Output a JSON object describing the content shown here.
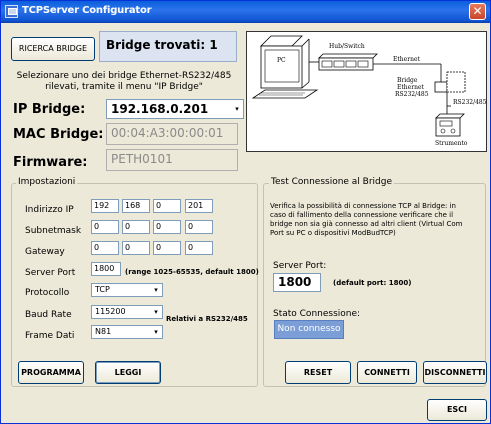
{
  "window": {
    "title": "TCPServer Configurator"
  },
  "header": {
    "search_button": "RICERCA BRIDGE",
    "found_label": "Bridge trovati: 1",
    "instruction_line1": "Selezionare uno dei bridge Ethernet-RS232/485",
    "instruction_line2": "rilevati, tramite il menu \"IP Bridge\""
  },
  "bridge": {
    "ip_label": "IP Bridge:",
    "ip_value": "192.168.0.201",
    "mac_label": "MAC Bridge:",
    "mac_value": "00:04:A3:00:00:01",
    "firmware_label": "Firmware:",
    "firmware_value": "PETH0101"
  },
  "diagram": {
    "pc": "PC",
    "hub": "Hub/Switch",
    "ethernet": "Ethernet",
    "bridge_lines": [
      "Bridge",
      "Ethernet",
      "RS232/485"
    ],
    "rs": "RS232/485",
    "device": "Strumento"
  },
  "settings": {
    "title": "Impostazioni",
    "ip_label": "Indirizzo  IP",
    "ip": [
      "192",
      "168",
      "0",
      "201"
    ],
    "subnet_label": "Subnetmask",
    "subnet": [
      "0",
      "0",
      "0",
      "0"
    ],
    "gateway_label": "Gateway",
    "gateway": [
      "0",
      "0",
      "0",
      "0"
    ],
    "port_label": "Server Port",
    "port_value": "1800",
    "port_hint": "(range 1025-65535, default 1800)",
    "protocol_label": "Protocollo",
    "protocol_value": "TCP",
    "baud_label": "Baud Rate",
    "baud_value": "115200",
    "rs_note": "Relativi a RS232/485",
    "frame_label": "Frame Dati",
    "frame_value": "N81",
    "program_button": "PROGRAMMA",
    "read_button": "LEGGI"
  },
  "test": {
    "title": "Test Connessione al Bridge",
    "description": [
      "Verifica la possibilità di connessione TCP al Bridge:  in",
      "caso di fallimento della connessione verificare che il",
      "bridge non sia già connesso ad altri client (Virtual Com",
      "Port su PC o dispositivi ModBudTCP)"
    ],
    "port_label": "Server Port:",
    "port_value": "1800",
    "port_hint": "(default port: 1800)",
    "status_label": "Stato Connessione:",
    "status_value": "Non connesso",
    "reset_button": "RESET",
    "connect_button": "CONNETTI",
    "disconnect_button": "DISCONNETTI"
  },
  "footer": {
    "exit_button": "ESCI"
  }
}
